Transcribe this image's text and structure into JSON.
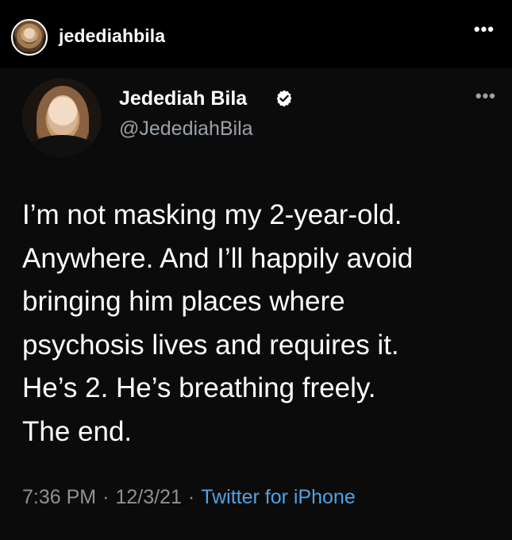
{
  "instagram_post": {
    "username": "jedediahbila",
    "more_icon": "more-horizontal-icon"
  },
  "tweet": {
    "display_name": "Jedediah Bila",
    "handle": "@JedediahBila",
    "verified_icon": "verified-badge-icon",
    "more_icon": "more-horizontal-icon",
    "text": "I’m not masking my 2-year-old.\nAnywhere. And I’ll happily avoid\nbringing him places where\npsychosis lives and requires it.\nHe’s 2. He’s breathing freely.\nThe end.",
    "time": "7:36 PM",
    "date": "12/3/21",
    "separator": "·",
    "source": "Twitter for iPhone",
    "colors": {
      "background": "#000000",
      "card_background": "#0b0b0b",
      "text": "#ffffff",
      "muted": "#8b9299",
      "link": "#4ea3e6"
    }
  }
}
